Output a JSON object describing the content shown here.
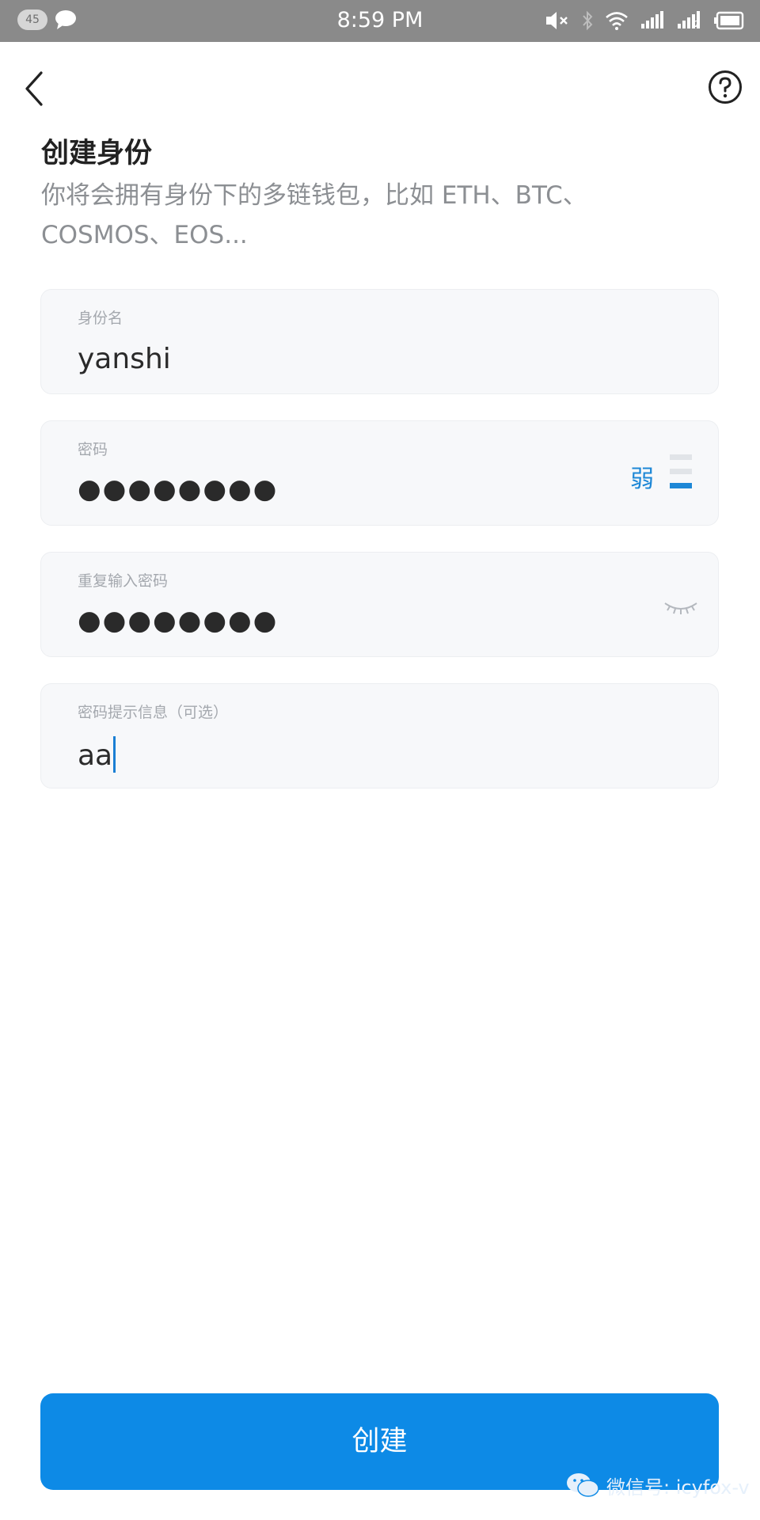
{
  "status_bar": {
    "notification_count": "45",
    "time": "8:59 PM",
    "sim2_label": "2",
    "icons": [
      "chat-bubble-icon",
      "mute-icon",
      "bluetooth-icon",
      "wifi-icon",
      "signal-icon",
      "battery-icon"
    ]
  },
  "nav": {
    "back_icon": "chevron-left-icon",
    "help_icon": "help-circle-icon"
  },
  "header": {
    "title": "创建身份",
    "subtitle": "你将会拥有身份下的多链钱包，比如 ETH、BTC、COSMOS、EOS..."
  },
  "form": {
    "identity_name": {
      "label": "身份名",
      "value": "yanshi"
    },
    "password": {
      "label": "密码",
      "value": "●●●●●●●●",
      "strength_label": "弱",
      "strength_level": 1,
      "strength_max": 3
    },
    "repeat_password": {
      "label": "重复输入密码",
      "value": "●●●●●●●●",
      "visibility_icon": "eye-closed-icon"
    },
    "password_hint": {
      "label": "密码提示信息（可选）",
      "value": "aa"
    }
  },
  "actions": {
    "create_label": "创建"
  },
  "watermark": {
    "text": "微信号: icyfox-v"
  },
  "colors": {
    "accent": "#0d8ae6",
    "strength": "#1d87d6",
    "status_bar": "#8a8a8a",
    "field_bg": "#f7f8fa"
  }
}
